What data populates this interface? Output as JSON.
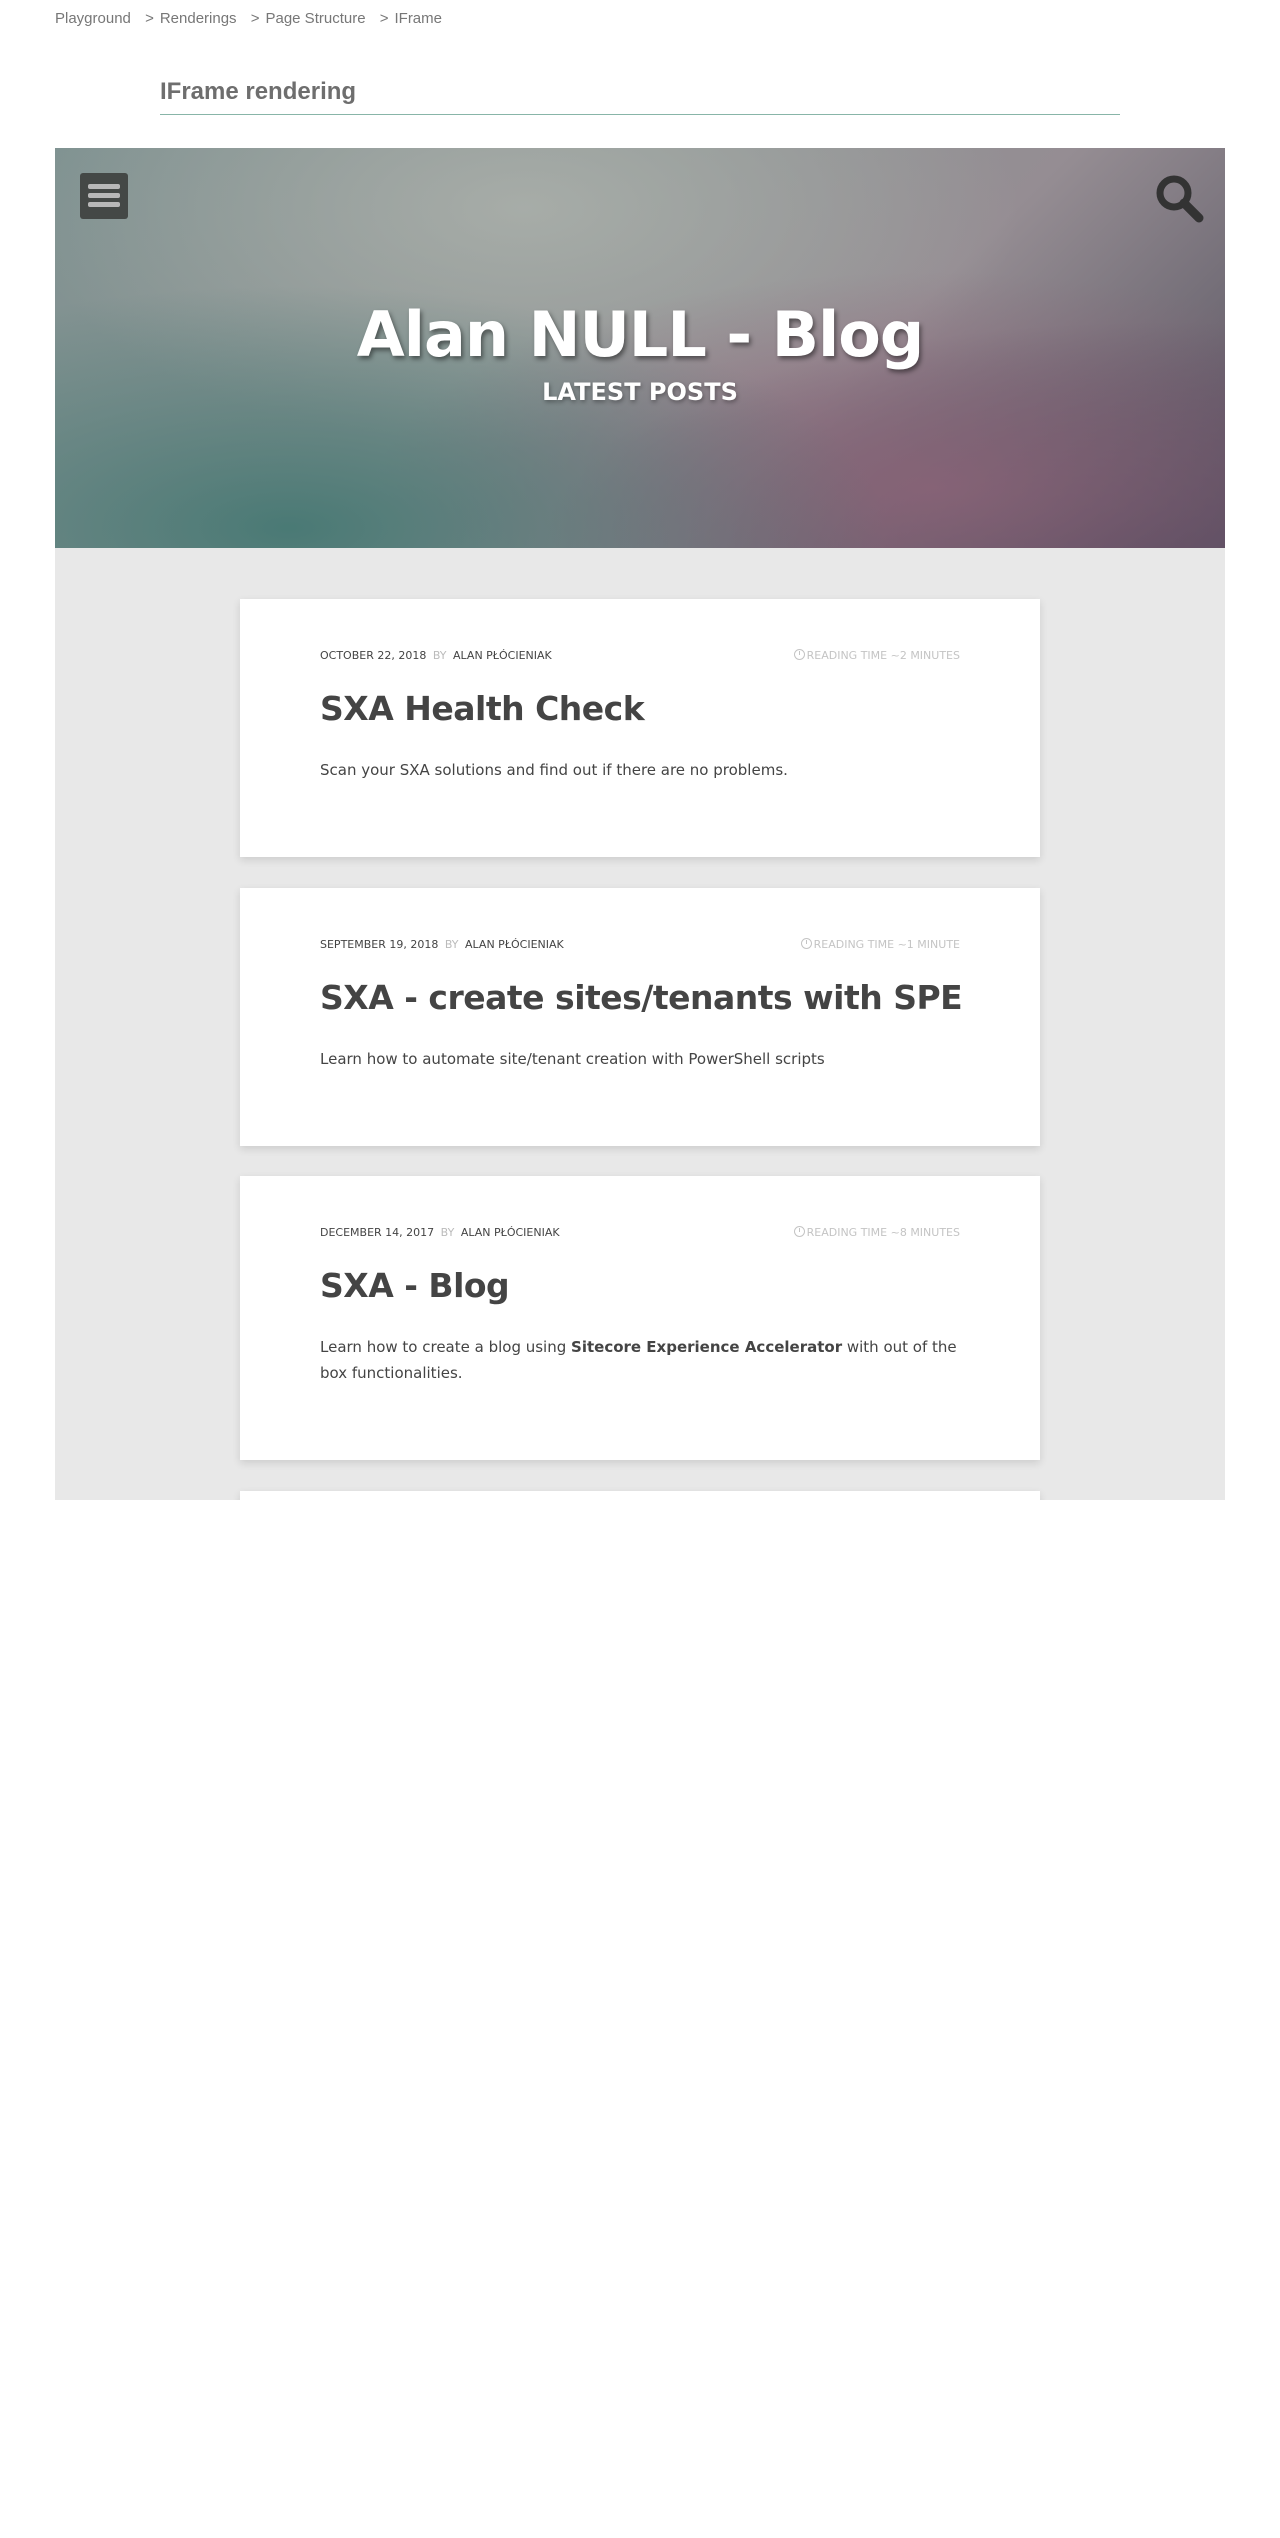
{
  "breadcrumb": {
    "items": [
      "Playground",
      "Renderings",
      "Page Structure",
      "IFrame"
    ],
    "separator": ">"
  },
  "page": {
    "heading": "IFrame rendering"
  },
  "blog": {
    "title": "Alan NULL - Blog",
    "subtitle": "LATEST POSTS",
    "menu_icon": "hamburger-menu-icon",
    "search_icon": "search-icon",
    "posts": [
      {
        "date": "OCTOBER 22, 2018",
        "by": "BY",
        "author": "ALAN PŁÓCIENIAK",
        "reading": "READING TIME ~2 MINUTES",
        "title": "SXA Health Check",
        "excerpt_before": "Scan your SXA solutions and find out if there are no problems.",
        "excerpt_bold": "",
        "excerpt_after": ""
      },
      {
        "date": "SEPTEMBER 19, 2018",
        "by": "BY",
        "author": "ALAN PŁÓCIENIAK",
        "reading": "READING TIME ~1 MINUTE",
        "title": "SXA - create sites/tenants with SPE",
        "excerpt_before": "Learn how to automate site/tenant creation with PowerShell scripts",
        "excerpt_bold": "",
        "excerpt_after": ""
      },
      {
        "date": "DECEMBER 14, 2017",
        "by": "BY",
        "author": "ALAN PŁÓCIENIAK",
        "reading": "READING TIME ~8 MINUTES",
        "title": "SXA - Blog",
        "excerpt_before": "Learn how to create a blog using ",
        "excerpt_bold": "Sitecore Experience Accelerator",
        "excerpt_after": " with out of the box functionalities."
      }
    ]
  },
  "colors": {
    "heading_underline": "#88b5a8",
    "content_bg": "#e8e8e8",
    "text": "#444444"
  }
}
